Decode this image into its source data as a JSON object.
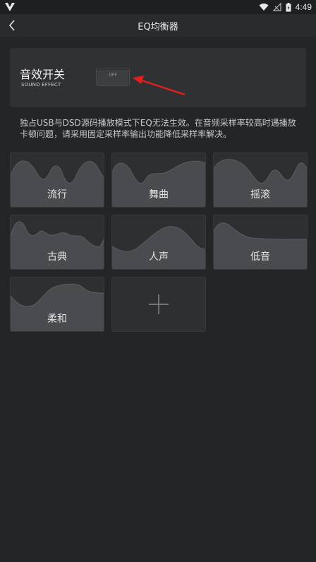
{
  "status_bar": {
    "time": "4:49"
  },
  "header": {
    "title": "EQ均衡器"
  },
  "sound_switch": {
    "title": "音效开关",
    "subtitle": "SOUND EFFECT",
    "toggle_state": "OFF"
  },
  "notice": "独占USB与DSD源码播放模式下EQ无法生效。在音频采样率较高时遇播放卡顿问题，请采用固定采样率输出功能降低采样率解决。",
  "presets": [
    {
      "label": "流行"
    },
    {
      "label": "舞曲"
    },
    {
      "label": "摇滚"
    },
    {
      "label": "古典"
    },
    {
      "label": "人声"
    },
    {
      "label": "低音"
    },
    {
      "label": "柔和"
    }
  ],
  "icons": {
    "back": "back-arrow-icon",
    "add": "plus-icon",
    "wifi": "wifi-icon",
    "signal": "no-signal-icon",
    "battery": "battery-icon",
    "logo": "v-logo-icon"
  },
  "colors": {
    "background": "#242527",
    "card": "#303133",
    "tile": "#2e2f31",
    "curve_fill": "#4a4b4e",
    "annotation_arrow": "#e0201e"
  }
}
